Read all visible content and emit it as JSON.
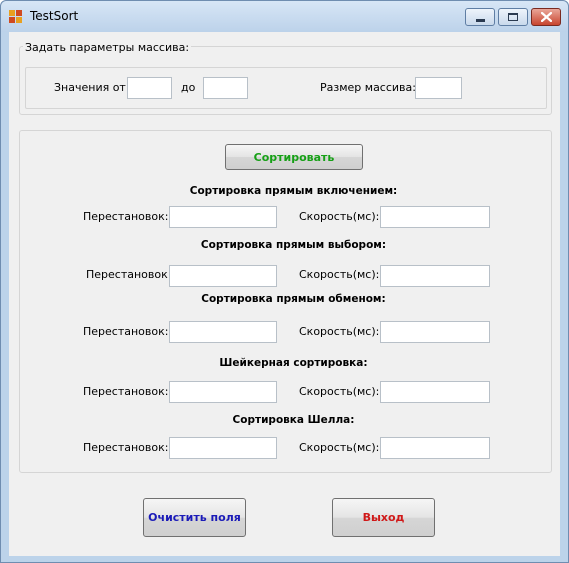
{
  "window": {
    "title": "TestSort"
  },
  "params": {
    "caption": "Задать параметры массива:",
    "from_label": "Значения от:",
    "from_value": "",
    "to_label": "до",
    "to_value": "",
    "size_label": "Размер массива:",
    "size_value": ""
  },
  "sort_button": {
    "label": "Сортировать",
    "color": "#16a016"
  },
  "sorts": [
    {
      "title": "Сортировка прямым включением:",
      "swaps_label": "Перестановок:",
      "swaps_value": "",
      "speed_label": "Скорость(мс):",
      "speed_value": ""
    },
    {
      "title": "Сортировка прямым выбором:",
      "swaps_label": "Перестановок:",
      "swaps_value": "",
      "speed_label": "Скорость(мс):",
      "speed_value": ""
    },
    {
      "title": "Сортировка прямым обменом:",
      "swaps_label": "Перестановок:",
      "swaps_value": "",
      "speed_label": "Скорость(мс):",
      "speed_value": ""
    },
    {
      "title": "Шейкерная сортировка:",
      "swaps_label": "Перестановок:",
      "swaps_value": "",
      "speed_label": "Скорость(мс):",
      "speed_value": ""
    },
    {
      "title": "Сортировка Шелла:",
      "swaps_label": "Перестановок:",
      "swaps_value": "",
      "speed_label": "Скорость(мс):",
      "speed_value": ""
    }
  ],
  "clear_button": {
    "label": "Очистить поля",
    "color": "#1a1ab8"
  },
  "exit_button": {
    "label": "Выход",
    "color": "#d01818"
  },
  "colors": {
    "titlebar": "#bcd3ea",
    "client_bg": "#f0f0f0",
    "close_button": "#c8452e"
  }
}
